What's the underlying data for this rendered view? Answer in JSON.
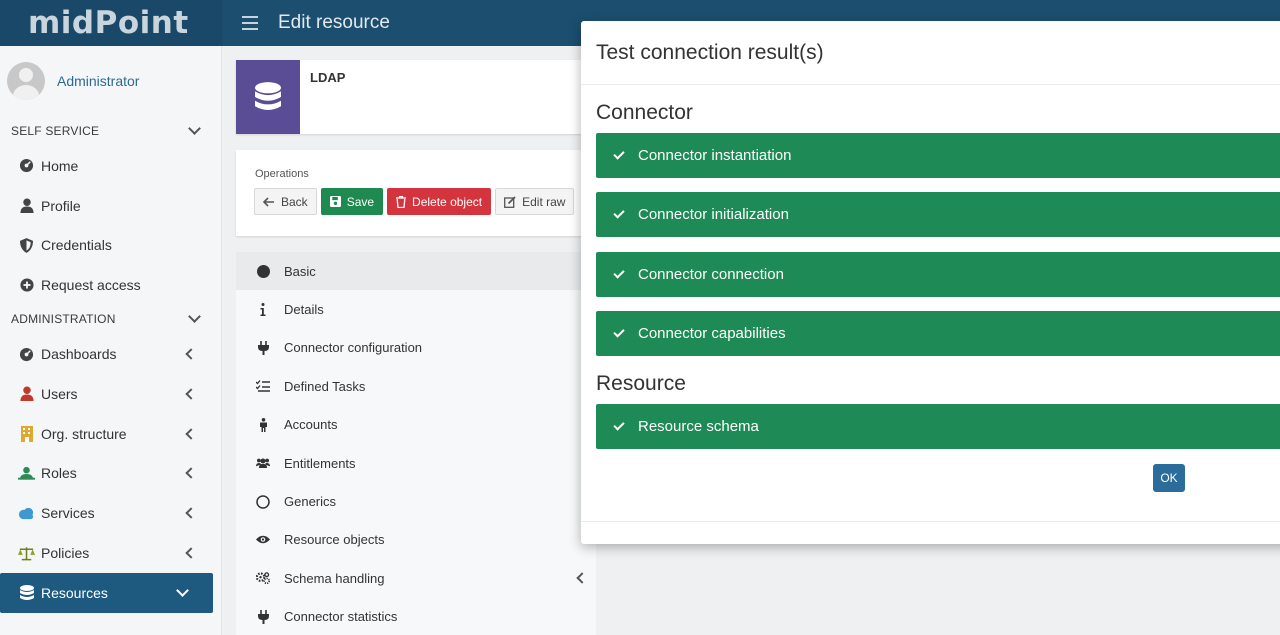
{
  "app": {
    "logo": "midPoint",
    "page_title": "Edit resource"
  },
  "user": {
    "name": "Administrator"
  },
  "sidebar": {
    "sections": [
      {
        "label": "SELF SERVICE",
        "items": [
          {
            "label": "Home",
            "icon": "dashboard-icon"
          },
          {
            "label": "Profile",
            "icon": "user-icon"
          },
          {
            "label": "Credentials",
            "icon": "shield-icon"
          },
          {
            "label": "Request access",
            "icon": "plus-circle-icon"
          }
        ]
      },
      {
        "label": "ADMINISTRATION",
        "items": [
          {
            "label": "Dashboards",
            "icon": "dashboard-icon"
          },
          {
            "label": "Users",
            "icon": "user-icon"
          },
          {
            "label": "Org. structure",
            "icon": "building-icon"
          },
          {
            "label": "Roles",
            "icon": "roles-icon"
          },
          {
            "label": "Services",
            "icon": "cloud-icon"
          },
          {
            "label": "Policies",
            "icon": "balance-scale-icon"
          },
          {
            "label": "Resources",
            "icon": "database-icon"
          }
        ]
      }
    ]
  },
  "resource": {
    "name": "LDAP"
  },
  "operations": {
    "label": "Operations",
    "back": "Back",
    "save": "Save",
    "delete": "Delete object",
    "edit_raw": "Edit raw"
  },
  "menu": [
    {
      "label": "Basic",
      "icon": "circle-icon"
    },
    {
      "label": "Details",
      "icon": "info-icon"
    },
    {
      "label": "Connector configuration",
      "icon": "plug-icon"
    },
    {
      "label": "Defined Tasks",
      "icon": "tasks-icon"
    },
    {
      "label": "Accounts",
      "icon": "person-icon"
    },
    {
      "label": "Entitlements",
      "icon": "users-icon"
    },
    {
      "label": "Generics",
      "icon": "circle-outline-icon"
    },
    {
      "label": "Resource objects",
      "icon": "eye-icon"
    },
    {
      "label": "Schema handling",
      "icon": "cogs-icon"
    },
    {
      "label": "Connector statistics",
      "icon": "plug-icon"
    }
  ],
  "modal": {
    "title": "Test connection result(s)",
    "connector_title": "Connector",
    "connector_results": [
      "Connector instantiation",
      "Connector initialization",
      "Connector connection",
      "Connector capabilities"
    ],
    "resource_title": "Resource",
    "resource_results": [
      "Resource schema"
    ],
    "ok": "OK"
  }
}
